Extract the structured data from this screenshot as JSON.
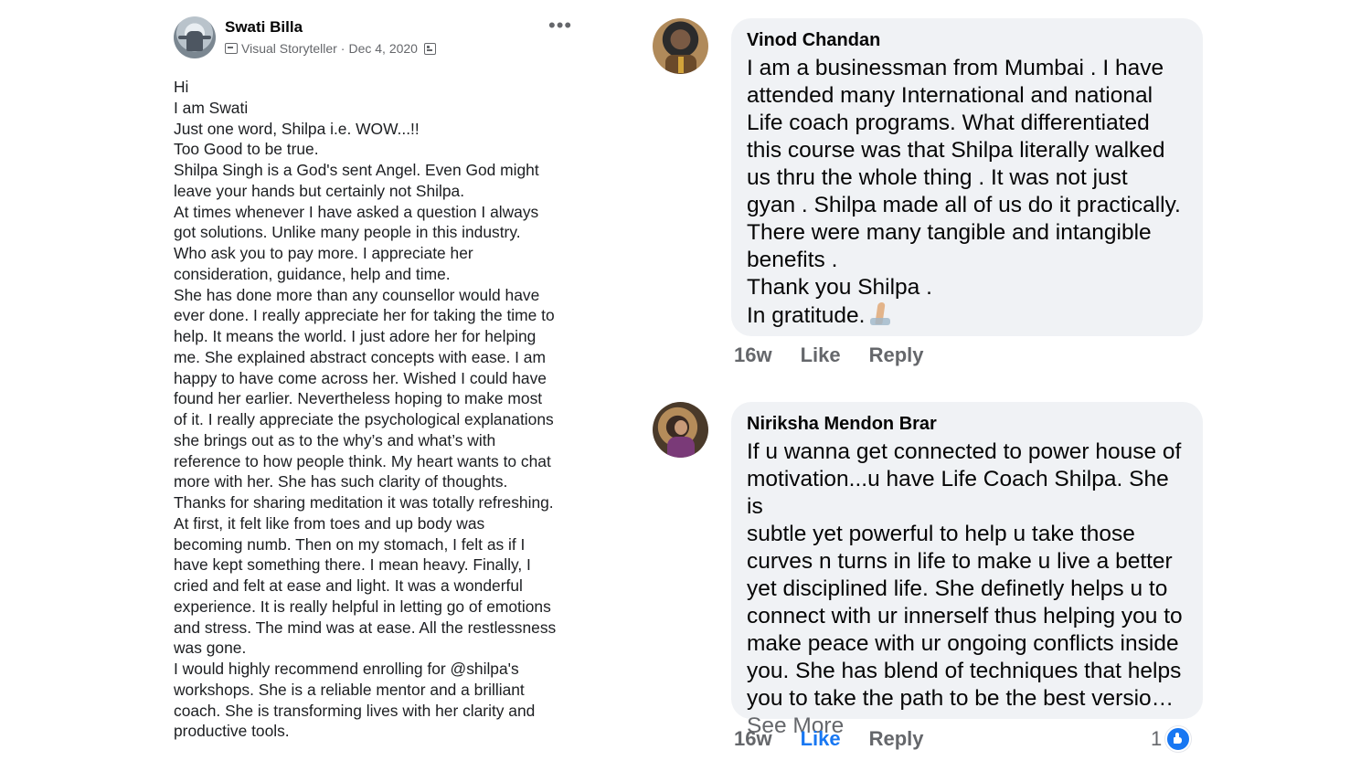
{
  "post": {
    "author": "Swati Billa",
    "subtitle": "Visual Storyteller",
    "separator": "·",
    "date": "Dec 4, 2020",
    "more_label": "•••",
    "body": "Hi\nI am Swati\nJust one word, Shilpa i.e. WOW...!!\nToo Good to be true.\nShilpa Singh is a God's sent Angel. Even God might\nleave your hands but certainly not Shilpa.\nAt times whenever I have asked a question I always\ngot solutions.  Unlike many people in this industry.\nWho ask you to pay more. I appreciate her\nconsideration, guidance, help and time.\n She has done more than any counsellor would have\never done. I really appreciate her for taking the time to\nhelp. It means the world.  I just adore her for helping\nme. She explained abstract concepts with ease. I am\nhappy to have come across her. Wished I could have\nfound her earlier. Nevertheless hoping to make most\nof it. I really appreciate the psychological explanations\nshe brings out as to the why’s and what’s with\nreference to how people think. My heart wants to chat\nmore with her. She has such clarity of thoughts.\nThanks for sharing meditation it was totally refreshing.\nAt first, it felt like from toes and up body was\nbecoming numb. Then on my stomach, I felt as if I\nhave kept something there. I mean heavy. Finally, I\ncried and felt at ease and light. It was a wonderful\nexperience. It is really helpful in letting go of emotions\nand stress. The mind was at ease. All the restlessness\nwas gone.\n I would highly recommend enrolling for @shilpa's\nworkshops. She is a reliable mentor and a brilliant\ncoach. She is transforming lives with her clarity and\nproductive tools."
  },
  "comments": [
    {
      "name": "Vinod Chandan",
      "text": "I am a businessman from Mumbai . I have\nattended many International and national\nLife coach programs. What differentiated\nthis course was that Shilpa literally walked\nus thru the whole thing . It was not just\ngyan . Shilpa made all of us do it practically.\nThere were many tangible and intangible\nbenefits .\nThank you Shilpa .",
      "last_line": "In gratitude.",
      "emoji": "folded-hands-emoji",
      "time": "16w",
      "like_label": "Like",
      "reply_label": "Reply"
    },
    {
      "name": "Niriksha Mendon Brar",
      "text": "If u wanna get connected to power house of\nmotivation...u have Life Coach Shilpa. She is\nsubtle yet powerful to help u take those\ncurves n turns in life to make u live a better\nyet disciplined life. She definetly helps u to\nconnect with ur innerself thus helping you to\nmake peace with ur ongoing conflicts inside\nyou. She has blend of techniques that helps\nyou to take the path to be the best versio…",
      "see_more": "See More",
      "time": "16w",
      "like_label": "Like",
      "reply_label": "Reply",
      "liked": true,
      "reaction_count": "1"
    }
  ],
  "colors": {
    "bubble": "#f0f2f5",
    "secondary_text": "#65676b",
    "like_blue": "#1877f2"
  }
}
